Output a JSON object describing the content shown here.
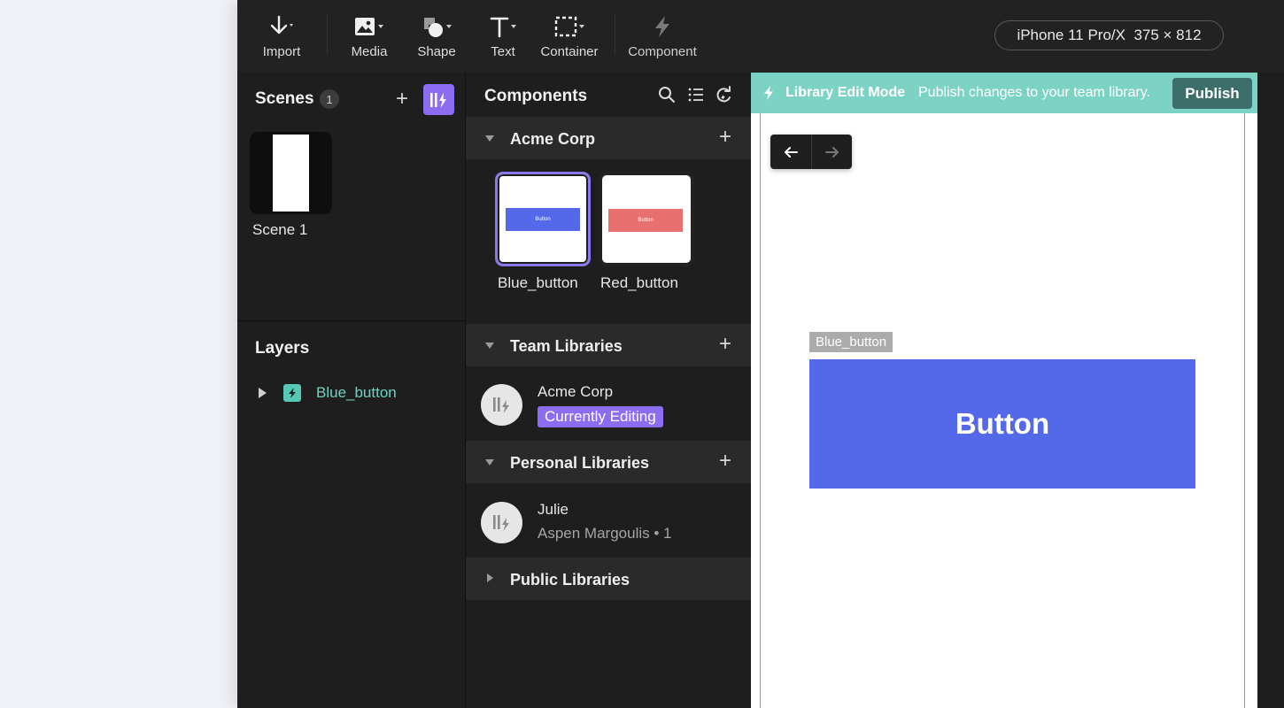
{
  "toolbar": {
    "import_label": "Import",
    "media_label": "Media",
    "shape_label": "Shape",
    "text_label": "Text",
    "container_label": "Container",
    "component_label": "Component",
    "device_name": "iPhone 11 Pro/X",
    "device_size": "375 × 812"
  },
  "scenes": {
    "title": "Scenes",
    "count": "1",
    "items": [
      {
        "label": "Scene 1"
      }
    ]
  },
  "layers": {
    "title": "Layers",
    "items": [
      {
        "label": "Blue_button"
      }
    ]
  },
  "components": {
    "title": "Components",
    "groups": {
      "acme": {
        "title": "Acme Corp"
      },
      "team": {
        "title": "Team Libraries"
      },
      "personal": {
        "title": "Personal Libraries"
      },
      "public": {
        "title": "Public Libraries"
      }
    },
    "cards": [
      {
        "label": "Blue_button",
        "inner_text": "Button",
        "color": "#5468ea"
      },
      {
        "label": "Red_button",
        "inner_text": "Button",
        "color": "#e97070"
      }
    ],
    "team_library": {
      "name": "Acme Corp",
      "badge": "Currently Editing"
    },
    "personal_library": {
      "name": "Julie",
      "subtitle": "Aspen Margoulis • 1"
    }
  },
  "canvas": {
    "banner_mode": "Library Edit Mode",
    "banner_message": "Publish changes to your team library.",
    "publish_label": "Publish",
    "selection_tag": "Blue_button",
    "button_text": "Button",
    "button_color": "#5468ea",
    "banner_color": "#7dd3c3",
    "accent_color": "#8c6df2"
  }
}
